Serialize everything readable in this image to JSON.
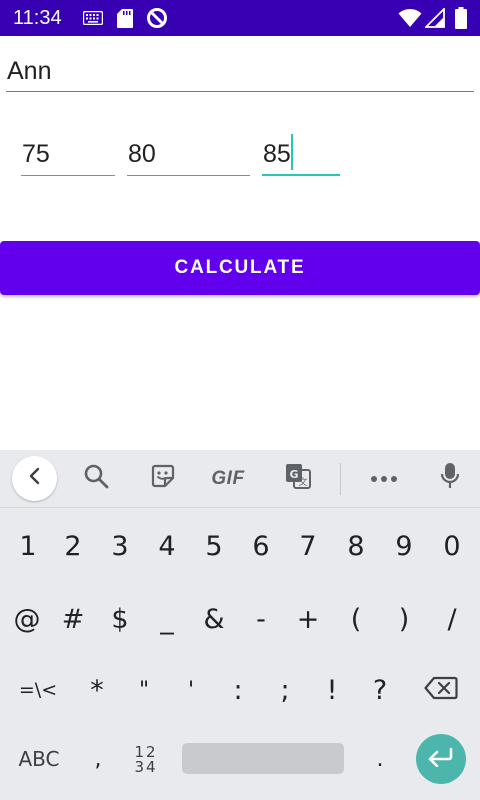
{
  "status_bar": {
    "time": "11:34",
    "icons": [
      "keyboard-icon",
      "sd-card-icon",
      "data-saver-icon",
      "wifi-icon",
      "signal-icon",
      "battery-icon"
    ],
    "background": "#3700b3"
  },
  "form": {
    "name_value": "Ann",
    "scores": [
      "75",
      "80",
      "85"
    ],
    "calculate_label": "CALCULATE",
    "accent_color": "#6200ee",
    "focus_color": "#26c6b8"
  },
  "keyboard": {
    "toolbar": [
      "back-icon",
      "search-icon",
      "sticker-icon",
      "GIF",
      "translate-icon",
      "more-icon",
      "mic-icon"
    ],
    "gif_label": "GIF",
    "row1": [
      "1",
      "2",
      "3",
      "4",
      "5",
      "6",
      "7",
      "8",
      "9",
      "0"
    ],
    "row2": [
      "@",
      "#",
      "$",
      "_",
      "&",
      "-",
      "+",
      "(",
      ")",
      "/"
    ],
    "row3": [
      "=\\<",
      "*",
      "\"",
      "'",
      ":",
      ";",
      "!",
      "?"
    ],
    "row4": {
      "abc": "ABC",
      "comma": ",",
      "num_toggle_top": "12",
      "num_toggle_bottom": "34",
      "period": "."
    },
    "enter_color": "#4db6ac"
  }
}
